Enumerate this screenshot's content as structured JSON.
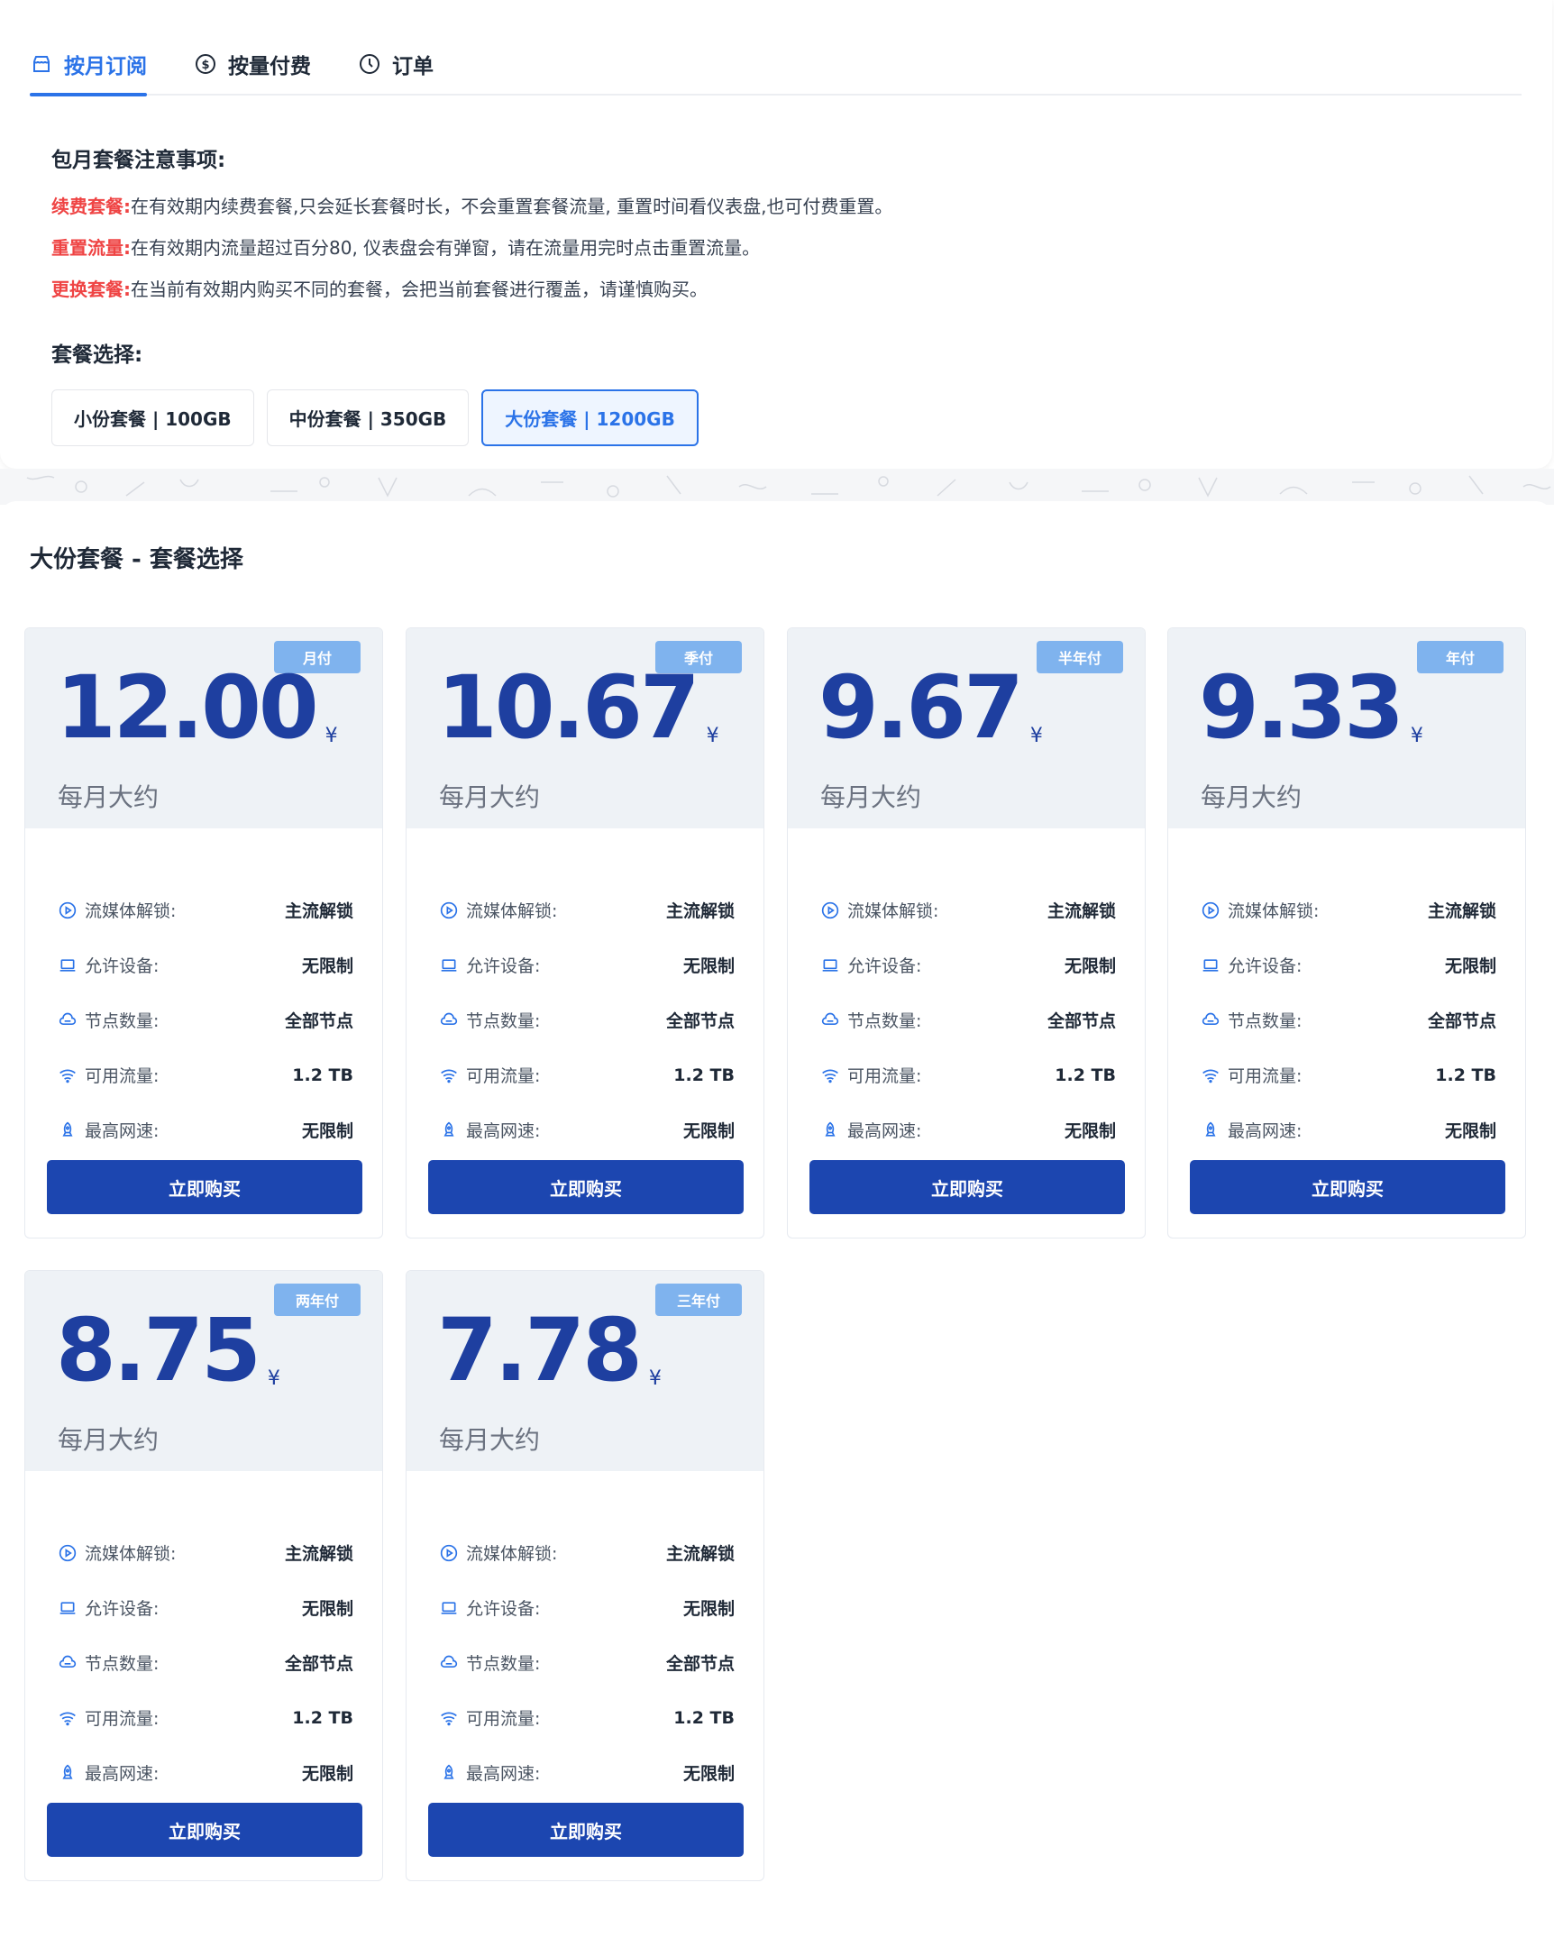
{
  "tabs": [
    {
      "label": "按月订阅",
      "icon": "shop-icon",
      "active": true
    },
    {
      "label": "按量付费",
      "icon": "dollar-icon",
      "active": false
    },
    {
      "label": "订单",
      "icon": "clock-icon",
      "active": false
    }
  ],
  "notice": {
    "title": "包月套餐注意事项:",
    "lines": [
      {
        "key": "续费套餐:",
        "text": "在有效期内续费套餐,只会延长套餐时长，不会重置套餐流量, 重置时间看仪表盘,也可付费重置。"
      },
      {
        "key": "重置流量:",
        "text": "在有效期内流量超过百分80, 仪表盘会有弹窗，请在流量用完时点击重置流量。"
      },
      {
        "key": "更换套餐:",
        "text": "在当前有效期内购买不同的套餐，会把当前套餐进行覆盖，请谨慎购买。"
      }
    ]
  },
  "package_select": {
    "title": "套餐选择:",
    "options": [
      {
        "label": "小份套餐 | 100GB",
        "active": false
      },
      {
        "label": "中份套餐 | 350GB",
        "active": false
      },
      {
        "label": "大份套餐 | 1200GB",
        "active": true
      }
    ]
  },
  "section_title": "大份套餐 - 套餐选择",
  "feature_labels": {
    "streaming": "流媒体解锁:",
    "devices": "允许设备:",
    "nodes": "节点数量:",
    "traffic": "可用流量:",
    "speed": "最高网速:"
  },
  "currency": "¥",
  "per_month": "每月大约",
  "buy_label": "立即购买",
  "colors": {
    "accent": "#2b73e8",
    "price": "#1e3fa0",
    "button": "#1c46b0",
    "badge": "#7fb3ee",
    "warning": "#ef4444"
  },
  "plans": [
    {
      "badge": "月付",
      "price": "12.00",
      "streaming": "主流解锁",
      "devices": "无限制",
      "nodes": "全部节点",
      "traffic": "1.2 TB",
      "speed": "无限制"
    },
    {
      "badge": "季付",
      "price": "10.67",
      "streaming": "主流解锁",
      "devices": "无限制",
      "nodes": "全部节点",
      "traffic": "1.2 TB",
      "speed": "无限制"
    },
    {
      "badge": "半年付",
      "price": "9.67",
      "streaming": "主流解锁",
      "devices": "无限制",
      "nodes": "全部节点",
      "traffic": "1.2 TB",
      "speed": "无限制"
    },
    {
      "badge": "年付",
      "price": "9.33",
      "streaming": "主流解锁",
      "devices": "无限制",
      "nodes": "全部节点",
      "traffic": "1.2 TB",
      "speed": "无限制"
    },
    {
      "badge": "两年付",
      "price": "8.75",
      "streaming": "主流解锁",
      "devices": "无限制",
      "nodes": "全部节点",
      "traffic": "1.2 TB",
      "speed": "无限制"
    },
    {
      "badge": "三年付",
      "price": "7.78",
      "streaming": "主流解锁",
      "devices": "无限制",
      "nodes": "全部节点",
      "traffic": "1.2 TB",
      "speed": "无限制"
    }
  ]
}
